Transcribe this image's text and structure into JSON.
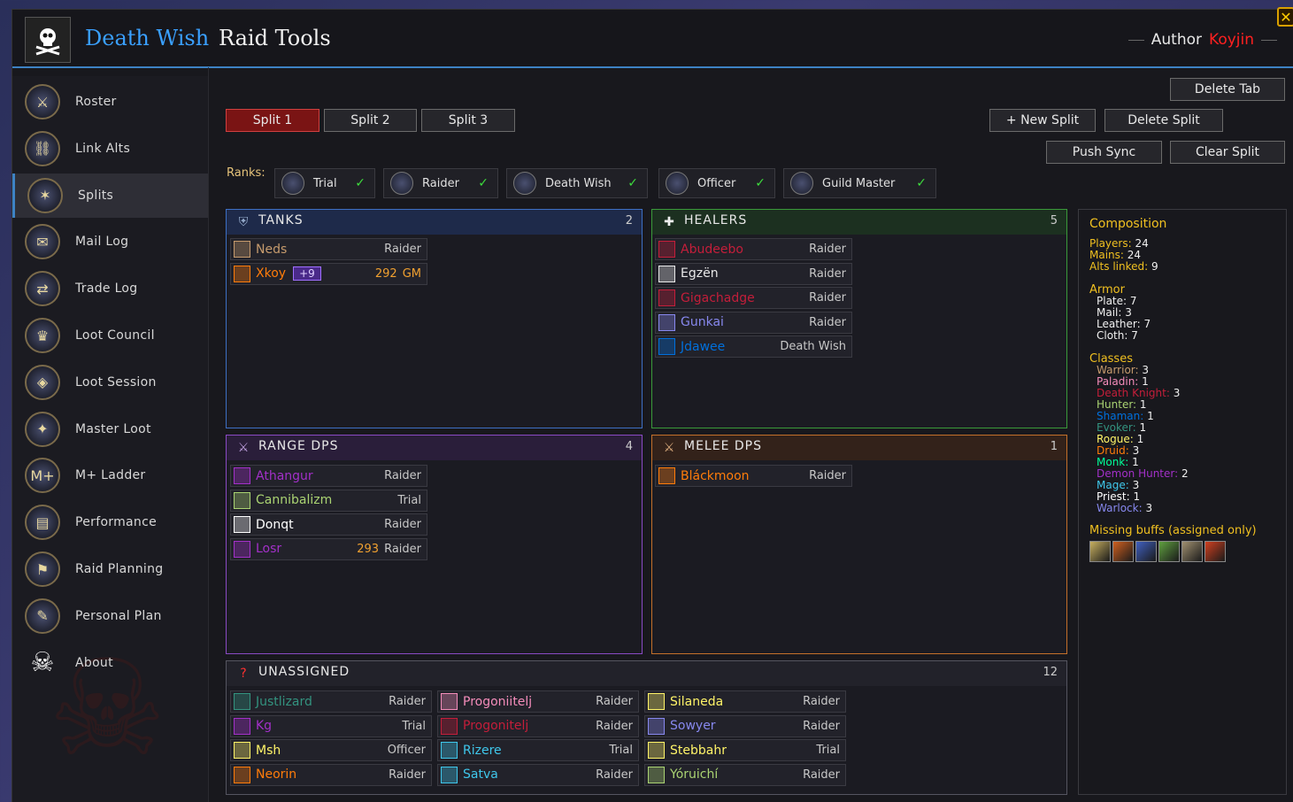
{
  "app": {
    "title_part1": "Death Wish",
    "title_part2": "Raid Tools",
    "author_label": "Author",
    "author_name": "Koyjin",
    "close_glyph": "✕"
  },
  "sidebar": {
    "items": [
      {
        "label": "Roster",
        "icon": "roster-icon"
      },
      {
        "label": "Link Alts",
        "icon": "link-alts-icon"
      },
      {
        "label": "Splits",
        "icon": "splits-icon",
        "active": true
      },
      {
        "label": "Mail Log",
        "icon": "mail-icon"
      },
      {
        "label": "Trade Log",
        "icon": "trade-icon"
      },
      {
        "label": "Loot Council",
        "icon": "loot-council-icon"
      },
      {
        "label": "Loot Session",
        "icon": "loot-session-icon"
      },
      {
        "label": "Master Loot",
        "icon": "master-loot-icon"
      },
      {
        "label": "M+ Ladder",
        "icon": "mplus-icon"
      },
      {
        "label": "Performance",
        "icon": "performance-icon"
      },
      {
        "label": "Raid Planning",
        "icon": "raid-planning-icon"
      },
      {
        "label": "Personal Plan",
        "icon": "personal-plan-icon"
      },
      {
        "label": "About",
        "icon": "skull-icon"
      }
    ]
  },
  "toolbar": {
    "split1": "Split 1",
    "split2": "Split 2",
    "split3": "Split 3",
    "delete_tab": "Delete Tab",
    "new_split": "+ New Split",
    "delete_split": "Delete Split",
    "push_sync": "Push Sync",
    "clear_split": "Clear Split"
  },
  "ranks": {
    "label": "Ranks:",
    "items": [
      {
        "name": "Trial",
        "checked": true
      },
      {
        "name": "Raider",
        "checked": true
      },
      {
        "name": "Death Wish",
        "checked": true
      },
      {
        "name": "Officer",
        "checked": true
      },
      {
        "name": "Guild Master",
        "checked": true
      }
    ]
  },
  "panels": {
    "tanks": {
      "title": "TANKS",
      "count": "2",
      "border": "#3d6fc4",
      "head_bg": "#1e2a4a",
      "rows": [
        {
          "name": "Neds",
          "rank": "Raider",
          "color": "#c69b6d"
        },
        {
          "name": "Xkoy",
          "alt": "+9",
          "ilvl": "292",
          "rank": "GM",
          "color": "#ff7c0a"
        }
      ]
    },
    "healers": {
      "title": "HEALERS",
      "count": "5",
      "border": "#3a9a3a",
      "head_bg": "#1c3020",
      "rows": [
        {
          "name": "Abudeebo",
          "rank": "Raider",
          "color": "#c41e3a"
        },
        {
          "name": "Egzën",
          "rank": "Raider",
          "color": "#e8e8e8"
        },
        {
          "name": "Gigachadge",
          "rank": "Raider",
          "color": "#c41e3a"
        },
        {
          "name": "Gunkai",
          "rank": "Raider",
          "color": "#8788ee"
        },
        {
          "name": "Jdawee",
          "rank": "Death Wish",
          "color": "#0070dd"
        }
      ]
    },
    "range": {
      "title": "RANGE DPS",
      "count": "4",
      "border": "#8a4ac4",
      "head_bg": "#2a1e3a",
      "rows": [
        {
          "name": "Athangur",
          "rank": "Raider",
          "color": "#a330c9"
        },
        {
          "name": "Cannibalizm",
          "rank": "Trial",
          "color": "#aad372"
        },
        {
          "name": "Donqt",
          "rank": "Raider",
          "color": "#ffffff"
        },
        {
          "name": "Losr",
          "ilvl": "293",
          "rank": "Raider",
          "color": "#a330c9"
        }
      ]
    },
    "melee": {
      "title": "MELEE DPS",
      "count": "1",
      "border": "#c4702a",
      "head_bg": "#33221a",
      "rows": [
        {
          "name": "Bláckmoon",
          "rank": "Raider",
          "color": "#ff7c0a"
        }
      ]
    },
    "unassigned": {
      "title": "UNASSIGNED",
      "count": "12",
      "border": "#555560",
      "head_bg": "#22222a",
      "columns": [
        [
          {
            "name": "Justlizard",
            "rank": "Raider",
            "color": "#33937f"
          },
          {
            "name": "Kg",
            "rank": "Trial",
            "color": "#a330c9"
          },
          {
            "name": "Msh",
            "rank": "Officer",
            "color": "#fff468"
          },
          {
            "name": "Neorin",
            "rank": "Raider",
            "color": "#ff7c0a"
          }
        ],
        [
          {
            "name": "Progoniitelj",
            "rank": "Raider",
            "color": "#f48cba"
          },
          {
            "name": "Progonitelj",
            "rank": "Raider",
            "color": "#c41e3a"
          },
          {
            "name": "Rizere",
            "rank": "Trial",
            "color": "#3fc7eb"
          },
          {
            "name": "Satva",
            "rank": "Raider",
            "color": "#3fc7eb"
          }
        ],
        [
          {
            "name": "Silaneda",
            "rank": "Raider",
            "color": "#fff468"
          },
          {
            "name": "Sowyer",
            "rank": "Raider",
            "color": "#8788ee"
          },
          {
            "name": "Stebbahr",
            "rank": "Trial",
            "color": "#fff468"
          },
          {
            "name": "Yóruichí",
            "rank": "Raider",
            "color": "#aad372"
          }
        ]
      ]
    }
  },
  "composition": {
    "title": "Composition",
    "players_label": "Players:",
    "players": "24",
    "mains_label": "Mains:",
    "mains": "24",
    "alts_label": "Alts linked:",
    "alts": "9",
    "armor_title": "Armor",
    "armor": [
      {
        "label": "Plate:",
        "value": "7"
      },
      {
        "label": "Mail:",
        "value": "3"
      },
      {
        "label": "Leather:",
        "value": "7"
      },
      {
        "label": "Cloth:",
        "value": "7"
      }
    ],
    "classes_title": "Classes",
    "classes": [
      {
        "label": "Warrior:",
        "value": "3",
        "color": "#c69b6d"
      },
      {
        "label": "Paladin:",
        "value": "1",
        "color": "#f48cba"
      },
      {
        "label": "Death Knight:",
        "value": "3",
        "color": "#c41e3a"
      },
      {
        "label": "Hunter:",
        "value": "1",
        "color": "#aad372"
      },
      {
        "label": "Shaman:",
        "value": "1",
        "color": "#0070dd"
      },
      {
        "label": "Evoker:",
        "value": "1",
        "color": "#33937f"
      },
      {
        "label": "Rogue:",
        "value": "1",
        "color": "#fff468"
      },
      {
        "label": "Druid:",
        "value": "3",
        "color": "#ff7c0a"
      },
      {
        "label": "Monk:",
        "value": "1",
        "color": "#00ff98"
      },
      {
        "label": "Demon Hunter:",
        "value": "2",
        "color": "#a330c9"
      },
      {
        "label": "Mage:",
        "value": "3",
        "color": "#3fc7eb"
      },
      {
        "label": "Priest:",
        "value": "1",
        "color": "#ffffff"
      },
      {
        "label": "Warlock:",
        "value": "3",
        "color": "#8788ee"
      }
    ],
    "missing_title": "Missing buffs (assigned only)",
    "buffs": [
      {
        "icon": "buff-icon-1",
        "color": "#c8b060"
      },
      {
        "icon": "buff-icon-2",
        "color": "#d06020"
      },
      {
        "icon": "buff-icon-3",
        "color": "#4060c0"
      },
      {
        "icon": "buff-icon-4",
        "color": "#60a040"
      },
      {
        "icon": "buff-icon-5",
        "color": "#a09070"
      },
      {
        "icon": "buff-icon-6",
        "color": "#d04020"
      }
    ]
  }
}
